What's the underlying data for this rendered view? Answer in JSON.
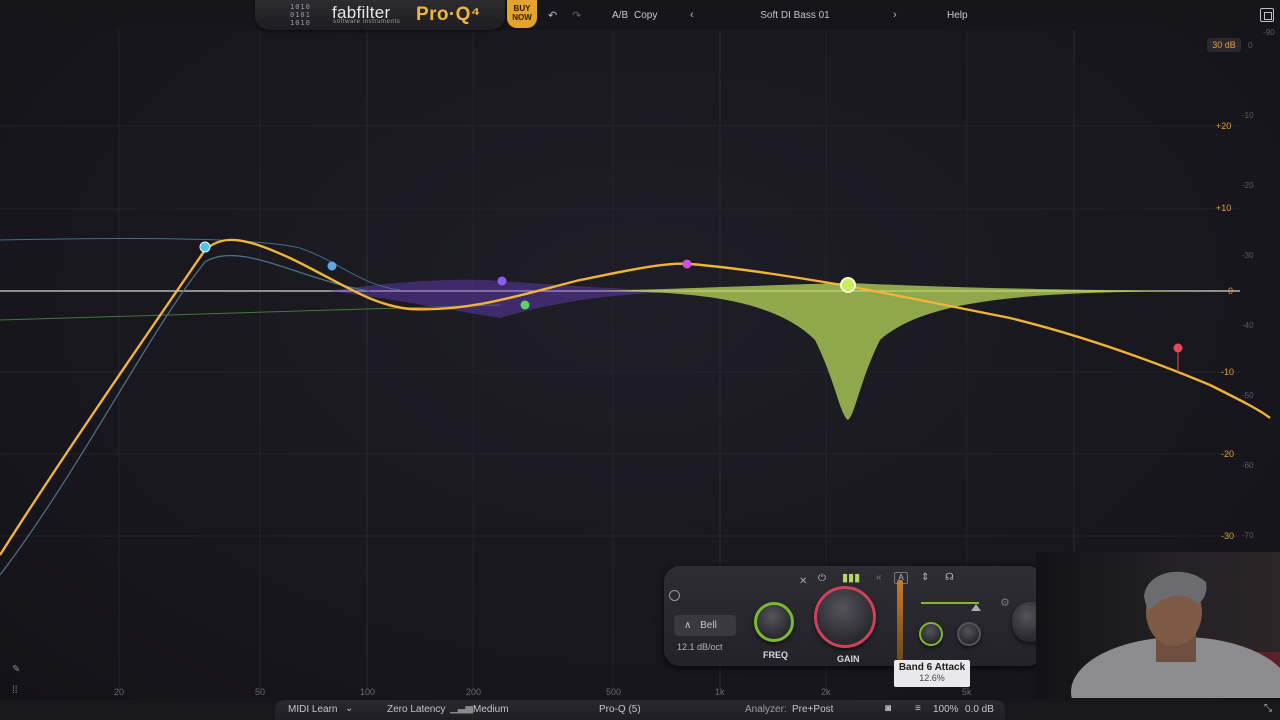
{
  "header": {
    "brand": "fabfilter",
    "brand_sub": "software instruments",
    "product": "Pro·Q⁴",
    "buy_line1": "BUY",
    "buy_line2": "NOW",
    "ab_label": "A/B",
    "copy_label": "Copy",
    "preset_name": "Soft DI Bass 01",
    "help_label": "Help"
  },
  "display": {
    "range": "30 dB",
    "gain_scale": [
      "+20",
      "+10",
      "0",
      "-10",
      "-20",
      "-30"
    ],
    "analyzer_scale": [
      "0",
      "-10",
      "-20",
      "-30",
      "-40",
      "-50",
      "-60",
      "-70",
      "-90"
    ],
    "freq_labels": [
      "20",
      "50",
      "100",
      "200",
      "500",
      "1k",
      "2k",
      "5k"
    ]
  },
  "band_panel": {
    "shape": "Bell",
    "slope": "12.1 dB/oct",
    "freq_label": "FREQ",
    "gain_label": "GAIN",
    "tooltip_title": "Band 6 Attack",
    "tooltip_value": "12.6%"
  },
  "bands": [
    {
      "color": "#4fc3e8"
    },
    {
      "color": "#5aa9e6"
    },
    {
      "color": "#8a5cf0"
    },
    {
      "color": "#5ad26a"
    },
    {
      "color": "#d04fe0"
    },
    {
      "color": "#c8ec5a"
    },
    {
      "color": "#e8485c"
    }
  ],
  "footer": {
    "midi_learn": "MIDI Learn",
    "latency": "Zero Latency",
    "quality": "Medium",
    "instance": "Pro-Q (5)",
    "analyzer_label": "Analyzer:",
    "analyzer_mode": "Pre+Post",
    "zoom": "100%",
    "output_gain": "0.0 dB"
  }
}
